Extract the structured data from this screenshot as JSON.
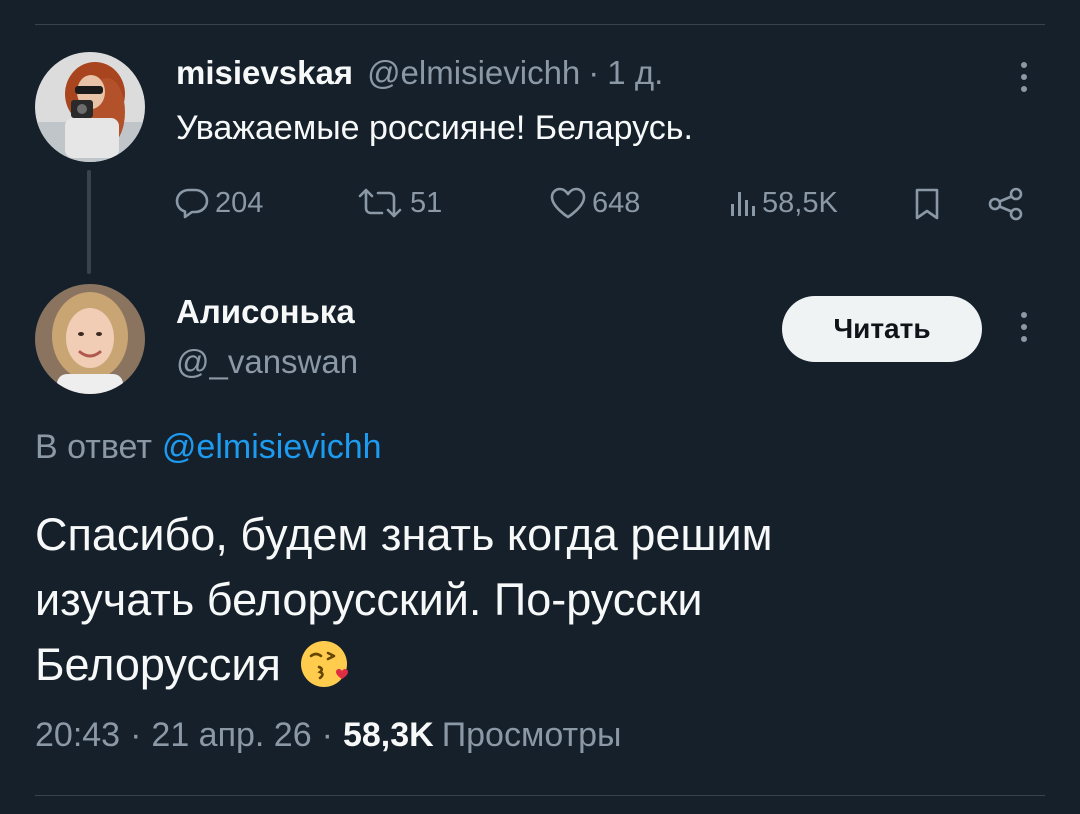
{
  "parent_tweet": {
    "display_name": "misievskaя",
    "handle": "@elmisievichh",
    "separator": "·",
    "time": "1 д.",
    "text": "Уважаемые россияне! Беларусь.",
    "actions": {
      "replies": "204",
      "retweets": "51",
      "likes": "648",
      "views": "58,5K"
    }
  },
  "reply_tweet": {
    "display_name": "Алисонька",
    "handle": "@_vanswan",
    "follow_label": "Читать",
    "reply_prefix": "В ответ",
    "reply_to_handle": "@elmisievichh",
    "body": "Спасибо, будем знать когда решим изучать белорусский. По-русски Белоруссия",
    "emoji": "face-blowing-a-kiss-emoji",
    "meta": {
      "time": "20:43",
      "separator": "·",
      "date": "21 апр. 26",
      "views_count": "58,3K",
      "views_label": "Просмотры"
    }
  },
  "icons": [
    "more-icon",
    "reply-icon",
    "retweet-icon",
    "like-icon",
    "views-icon",
    "bookmark-icon",
    "share-icon"
  ],
  "colors": {
    "background": "#15202b",
    "text": "#f7f9f9",
    "muted": "#8b98a5",
    "link": "#1d9bf0",
    "button_bg": "#eff3f4"
  }
}
